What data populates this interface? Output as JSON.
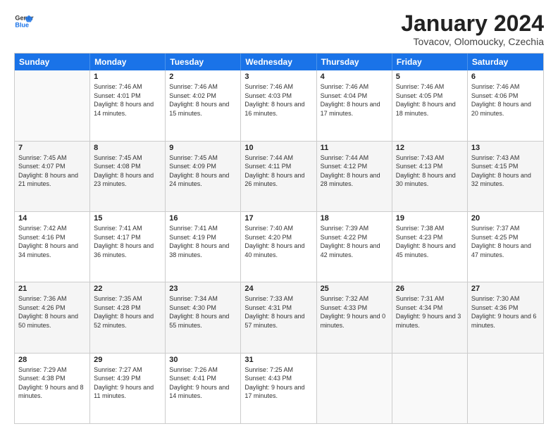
{
  "logo": {
    "line1": "General",
    "line2": "Blue"
  },
  "title": "January 2024",
  "subtitle": "Tovacov, Olomoucky, Czechia",
  "header_days": [
    "Sunday",
    "Monday",
    "Tuesday",
    "Wednesday",
    "Thursday",
    "Friday",
    "Saturday"
  ],
  "rows": [
    [
      {
        "day": "",
        "sunrise": "",
        "sunset": "",
        "daylight": ""
      },
      {
        "day": "1",
        "sunrise": "Sunrise: 7:46 AM",
        "sunset": "Sunset: 4:01 PM",
        "daylight": "Daylight: 8 hours and 14 minutes."
      },
      {
        "day": "2",
        "sunrise": "Sunrise: 7:46 AM",
        "sunset": "Sunset: 4:02 PM",
        "daylight": "Daylight: 8 hours and 15 minutes."
      },
      {
        "day": "3",
        "sunrise": "Sunrise: 7:46 AM",
        "sunset": "Sunset: 4:03 PM",
        "daylight": "Daylight: 8 hours and 16 minutes."
      },
      {
        "day": "4",
        "sunrise": "Sunrise: 7:46 AM",
        "sunset": "Sunset: 4:04 PM",
        "daylight": "Daylight: 8 hours and 17 minutes."
      },
      {
        "day": "5",
        "sunrise": "Sunrise: 7:46 AM",
        "sunset": "Sunset: 4:05 PM",
        "daylight": "Daylight: 8 hours and 18 minutes."
      },
      {
        "day": "6",
        "sunrise": "Sunrise: 7:46 AM",
        "sunset": "Sunset: 4:06 PM",
        "daylight": "Daylight: 8 hours and 20 minutes."
      }
    ],
    [
      {
        "day": "7",
        "sunrise": "Sunrise: 7:45 AM",
        "sunset": "Sunset: 4:07 PM",
        "daylight": "Daylight: 8 hours and 21 minutes."
      },
      {
        "day": "8",
        "sunrise": "Sunrise: 7:45 AM",
        "sunset": "Sunset: 4:08 PM",
        "daylight": "Daylight: 8 hours and 23 minutes."
      },
      {
        "day": "9",
        "sunrise": "Sunrise: 7:45 AM",
        "sunset": "Sunset: 4:09 PM",
        "daylight": "Daylight: 8 hours and 24 minutes."
      },
      {
        "day": "10",
        "sunrise": "Sunrise: 7:44 AM",
        "sunset": "Sunset: 4:11 PM",
        "daylight": "Daylight: 8 hours and 26 minutes."
      },
      {
        "day": "11",
        "sunrise": "Sunrise: 7:44 AM",
        "sunset": "Sunset: 4:12 PM",
        "daylight": "Daylight: 8 hours and 28 minutes."
      },
      {
        "day": "12",
        "sunrise": "Sunrise: 7:43 AM",
        "sunset": "Sunset: 4:13 PM",
        "daylight": "Daylight: 8 hours and 30 minutes."
      },
      {
        "day": "13",
        "sunrise": "Sunrise: 7:43 AM",
        "sunset": "Sunset: 4:15 PM",
        "daylight": "Daylight: 8 hours and 32 minutes."
      }
    ],
    [
      {
        "day": "14",
        "sunrise": "Sunrise: 7:42 AM",
        "sunset": "Sunset: 4:16 PM",
        "daylight": "Daylight: 8 hours and 34 minutes."
      },
      {
        "day": "15",
        "sunrise": "Sunrise: 7:41 AM",
        "sunset": "Sunset: 4:17 PM",
        "daylight": "Daylight: 8 hours and 36 minutes."
      },
      {
        "day": "16",
        "sunrise": "Sunrise: 7:41 AM",
        "sunset": "Sunset: 4:19 PM",
        "daylight": "Daylight: 8 hours and 38 minutes."
      },
      {
        "day": "17",
        "sunrise": "Sunrise: 7:40 AM",
        "sunset": "Sunset: 4:20 PM",
        "daylight": "Daylight: 8 hours and 40 minutes."
      },
      {
        "day": "18",
        "sunrise": "Sunrise: 7:39 AM",
        "sunset": "Sunset: 4:22 PM",
        "daylight": "Daylight: 8 hours and 42 minutes."
      },
      {
        "day": "19",
        "sunrise": "Sunrise: 7:38 AM",
        "sunset": "Sunset: 4:23 PM",
        "daylight": "Daylight: 8 hours and 45 minutes."
      },
      {
        "day": "20",
        "sunrise": "Sunrise: 7:37 AM",
        "sunset": "Sunset: 4:25 PM",
        "daylight": "Daylight: 8 hours and 47 minutes."
      }
    ],
    [
      {
        "day": "21",
        "sunrise": "Sunrise: 7:36 AM",
        "sunset": "Sunset: 4:26 PM",
        "daylight": "Daylight: 8 hours and 50 minutes."
      },
      {
        "day": "22",
        "sunrise": "Sunrise: 7:35 AM",
        "sunset": "Sunset: 4:28 PM",
        "daylight": "Daylight: 8 hours and 52 minutes."
      },
      {
        "day": "23",
        "sunrise": "Sunrise: 7:34 AM",
        "sunset": "Sunset: 4:30 PM",
        "daylight": "Daylight: 8 hours and 55 minutes."
      },
      {
        "day": "24",
        "sunrise": "Sunrise: 7:33 AM",
        "sunset": "Sunset: 4:31 PM",
        "daylight": "Daylight: 8 hours and 57 minutes."
      },
      {
        "day": "25",
        "sunrise": "Sunrise: 7:32 AM",
        "sunset": "Sunset: 4:33 PM",
        "daylight": "Daylight: 9 hours and 0 minutes."
      },
      {
        "day": "26",
        "sunrise": "Sunrise: 7:31 AM",
        "sunset": "Sunset: 4:34 PM",
        "daylight": "Daylight: 9 hours and 3 minutes."
      },
      {
        "day": "27",
        "sunrise": "Sunrise: 7:30 AM",
        "sunset": "Sunset: 4:36 PM",
        "daylight": "Daylight: 9 hours and 6 minutes."
      }
    ],
    [
      {
        "day": "28",
        "sunrise": "Sunrise: 7:29 AM",
        "sunset": "Sunset: 4:38 PM",
        "daylight": "Daylight: 9 hours and 8 minutes."
      },
      {
        "day": "29",
        "sunrise": "Sunrise: 7:27 AM",
        "sunset": "Sunset: 4:39 PM",
        "daylight": "Daylight: 9 hours and 11 minutes."
      },
      {
        "day": "30",
        "sunrise": "Sunrise: 7:26 AM",
        "sunset": "Sunset: 4:41 PM",
        "daylight": "Daylight: 9 hours and 14 minutes."
      },
      {
        "day": "31",
        "sunrise": "Sunrise: 7:25 AM",
        "sunset": "Sunset: 4:43 PM",
        "daylight": "Daylight: 9 hours and 17 minutes."
      },
      {
        "day": "",
        "sunrise": "",
        "sunset": "",
        "daylight": ""
      },
      {
        "day": "",
        "sunrise": "",
        "sunset": "",
        "daylight": ""
      },
      {
        "day": "",
        "sunrise": "",
        "sunset": "",
        "daylight": ""
      }
    ]
  ]
}
